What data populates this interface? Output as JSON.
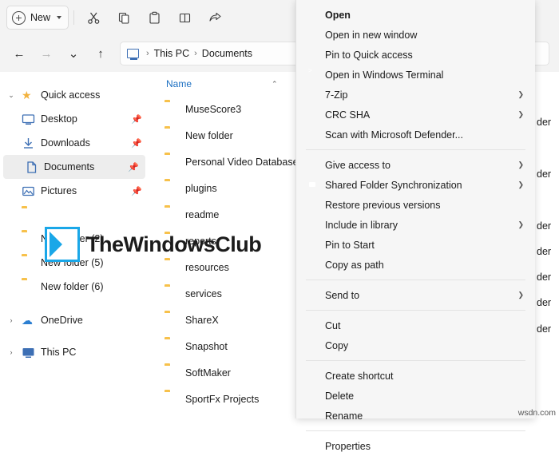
{
  "toolbar": {
    "new_label": "New",
    "new_chevron": "▾",
    "buttons": [
      {
        "name": "cut-button",
        "glyph": "✂"
      },
      {
        "name": "copy-button",
        "glyph": "❐"
      },
      {
        "name": "paste-button",
        "glyph": "📋"
      },
      {
        "name": "rename-button",
        "glyph": "✎"
      },
      {
        "name": "share-button",
        "glyph": "↗"
      }
    ]
  },
  "addressbar": {
    "back": "←",
    "forward": "→",
    "recent": "⌄",
    "up": "↑",
    "crumbs": [
      "This PC",
      "Documents"
    ],
    "separator": "›"
  },
  "sidebar": {
    "items": [
      {
        "label": "Quick access",
        "icon": "star-icon",
        "chevron": "⌄",
        "pinned": false,
        "selected": false
      },
      {
        "label": "Desktop",
        "icon": "desktop-icon",
        "chevron": "",
        "pinned": true,
        "selected": false
      },
      {
        "label": "Downloads",
        "icon": "downloads-icon",
        "chevron": "",
        "pinned": true,
        "selected": false
      },
      {
        "label": "Documents",
        "icon": "documents-icon",
        "chevron": "",
        "pinned": true,
        "selected": true
      },
      {
        "label": "Pictures",
        "icon": "pictures-icon",
        "chevron": "",
        "pinned": true,
        "selected": false
      },
      {
        "label": "",
        "icon": "folder-icon",
        "chevron": "",
        "pinned": false,
        "selected": false
      },
      {
        "label": "New folder (2)",
        "icon": "folder-icon",
        "chevron": "",
        "pinned": false,
        "selected": false
      },
      {
        "label": "New folder (5)",
        "icon": "folder-icon",
        "chevron": "",
        "pinned": false,
        "selected": false
      },
      {
        "label": "New folder (6)",
        "icon": "folder-icon",
        "chevron": "",
        "pinned": false,
        "selected": false
      },
      {
        "label": "OneDrive",
        "icon": "onedrive-icon",
        "chevron": "›",
        "pinned": false,
        "selected": false
      },
      {
        "label": "This PC",
        "icon": "thispc-icon",
        "chevron": "›",
        "pinned": false,
        "selected": false
      }
    ]
  },
  "filelist": {
    "column_header": "Name",
    "sort_caret": "⌃",
    "rows": [
      {
        "name": "MuseScore3"
      },
      {
        "name": "New folder"
      },
      {
        "name": "Personal Video Database"
      },
      {
        "name": "plugins"
      },
      {
        "name": "readme"
      },
      {
        "name": "reports"
      },
      {
        "name": "resources"
      },
      {
        "name": "services"
      },
      {
        "name": "ShareX"
      },
      {
        "name": "Snapshot"
      },
      {
        "name": "SoftMaker"
      },
      {
        "name": "SportFx Projects"
      }
    ],
    "truncated_right": [
      "der",
      "der",
      "der",
      "der",
      "der",
      "der",
      "der"
    ]
  },
  "contextmenu": {
    "items": [
      {
        "label": "Open",
        "bold": true,
        "icon": "",
        "submenu": false,
        "separator_after": false
      },
      {
        "label": "Open in new window",
        "bold": false,
        "icon": "",
        "submenu": false,
        "separator_after": false
      },
      {
        "label": "Pin to Quick access",
        "bold": false,
        "icon": "",
        "submenu": false,
        "separator_after": false
      },
      {
        "label": "Open in Windows Terminal",
        "bold": false,
        "icon": "terminal-icon",
        "submenu": false,
        "separator_after": false
      },
      {
        "label": "7-Zip",
        "bold": false,
        "icon": "",
        "submenu": true,
        "separator_after": false
      },
      {
        "label": "CRC SHA",
        "bold": false,
        "icon": "",
        "submenu": true,
        "separator_after": false
      },
      {
        "label": "Scan with Microsoft Defender...",
        "bold": false,
        "icon": "shield-icon",
        "submenu": false,
        "separator_after": true
      },
      {
        "label": "Give access to",
        "bold": false,
        "icon": "",
        "submenu": true,
        "separator_after": false
      },
      {
        "label": "Shared Folder Synchronization",
        "bold": false,
        "icon": "sync-icon",
        "submenu": true,
        "separator_after": false
      },
      {
        "label": "Restore previous versions",
        "bold": false,
        "icon": "",
        "submenu": false,
        "separator_after": false
      },
      {
        "label": "Include in library",
        "bold": false,
        "icon": "",
        "submenu": true,
        "separator_after": false
      },
      {
        "label": "Pin to Start",
        "bold": false,
        "icon": "",
        "submenu": false,
        "separator_after": false
      },
      {
        "label": "Copy as path",
        "bold": false,
        "icon": "",
        "submenu": false,
        "separator_after": true
      },
      {
        "label": "Send to",
        "bold": false,
        "icon": "",
        "submenu": true,
        "separator_after": true
      },
      {
        "label": "Cut",
        "bold": false,
        "icon": "",
        "submenu": false,
        "separator_after": false
      },
      {
        "label": "Copy",
        "bold": false,
        "icon": "",
        "submenu": false,
        "separator_after": true
      },
      {
        "label": "Create shortcut",
        "bold": false,
        "icon": "",
        "submenu": false,
        "separator_after": false
      },
      {
        "label": "Delete",
        "bold": false,
        "icon": "",
        "submenu": false,
        "separator_after": false
      },
      {
        "label": "Rename",
        "bold": false,
        "icon": "",
        "submenu": false,
        "separator_after": true
      },
      {
        "label": "Properties",
        "bold": false,
        "icon": "",
        "submenu": false,
        "separator_after": false
      }
    ]
  },
  "watermark": {
    "text": "TheWindowsClub",
    "corner_url": "wsdn.com"
  }
}
